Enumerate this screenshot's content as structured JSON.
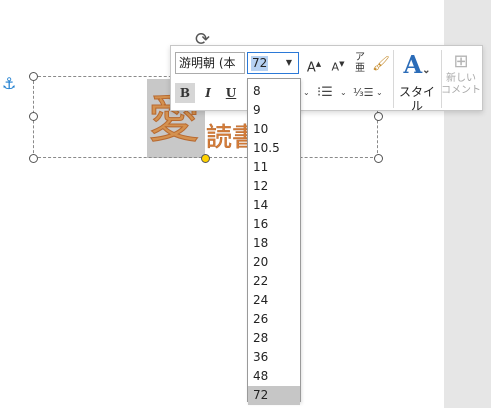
{
  "document": {
    "big_char": "愛",
    "small_text": "読書"
  },
  "toolbar": {
    "font_name": "游明朝 (本",
    "font_size": "72",
    "style_label": "スタイル",
    "comment_label_line1": "新しい",
    "comment_label_line2": "コメント",
    "bold": "B",
    "italic": "I",
    "underline": "U"
  },
  "font_size_options": [
    "8",
    "9",
    "10",
    "10.5",
    "11",
    "12",
    "14",
    "16",
    "18",
    "20",
    "22",
    "24",
    "26",
    "28",
    "36",
    "48",
    "72"
  ],
  "selected_font_size": "72",
  "colors": {
    "accent": "#2b79d7",
    "text_fill": "#d4914f",
    "selection_gray": "#c8c8c8",
    "anchor": "#1f7fd0"
  },
  "icons": {
    "anchor": "anchor-icon",
    "rotate": "rotate-icon",
    "grow_font": "grow-font-icon",
    "shrink_font": "shrink-font-icon",
    "phonetic": "phonetic-guide-icon",
    "format_painter": "format-painter-icon",
    "bullets": "bullets-icon",
    "numbering": "numbering-icon",
    "styles": "styles-icon",
    "new_comment": "new-comment-icon"
  }
}
